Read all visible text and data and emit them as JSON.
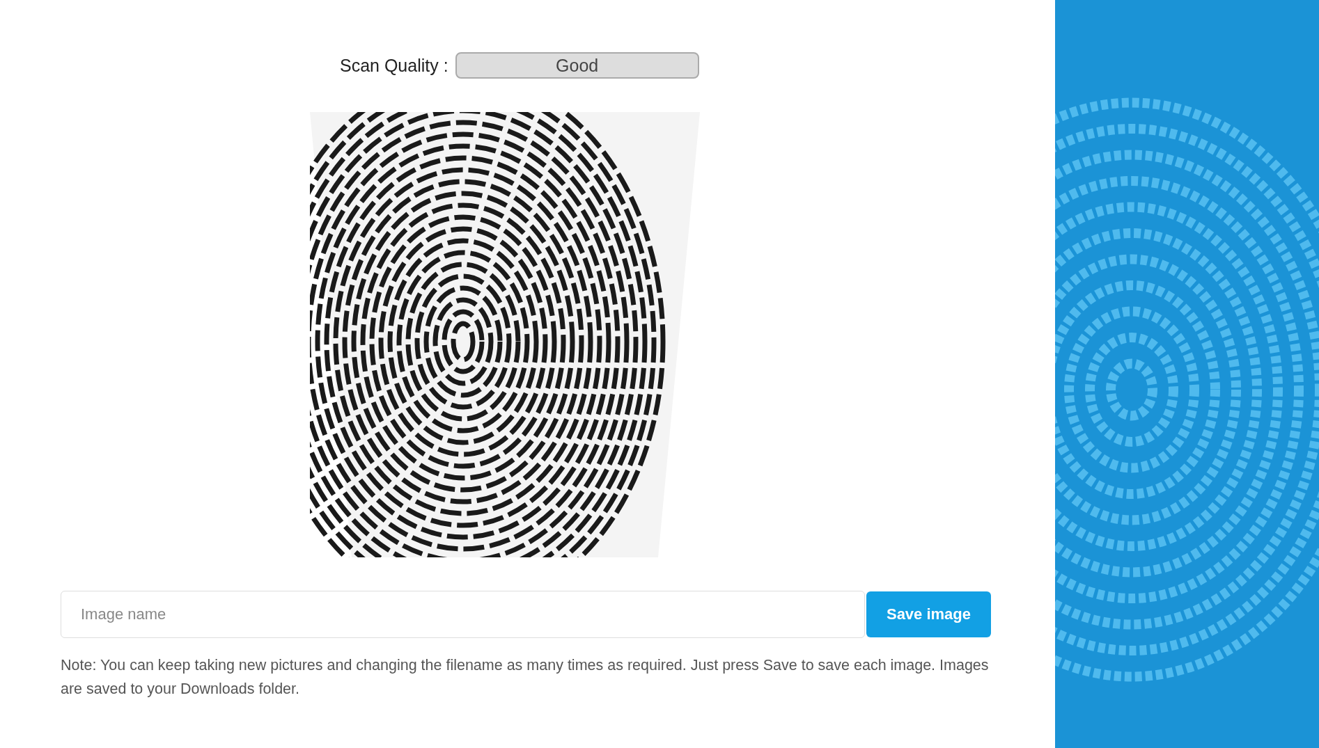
{
  "scan_quality": {
    "label": "Scan Quality :",
    "value": "Good"
  },
  "image_name": {
    "placeholder": "Image name"
  },
  "save_button": "Save image",
  "note": "Note: You can keep taking new pictures and changing the filename as many times as required. Just press Save to save each image. Images are saved to your Downloads folder."
}
